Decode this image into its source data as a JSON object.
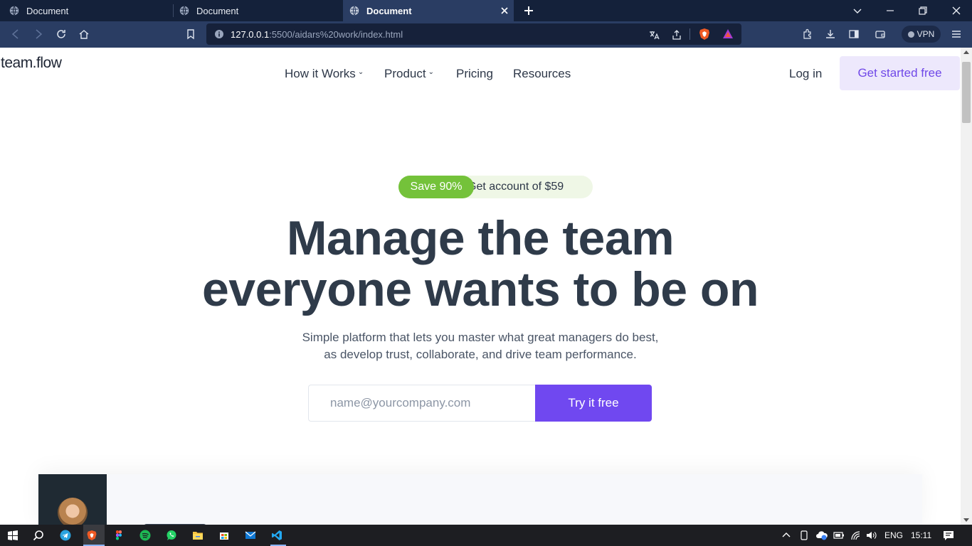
{
  "browser": {
    "tabs": [
      {
        "title": "Document",
        "active": false
      },
      {
        "title": "Document",
        "active": false
      },
      {
        "title": "Document",
        "active": true
      }
    ],
    "url_host": "127.0.0.1",
    "url_rest": ":5500/aidars%20work/index.html",
    "vpn_label": "VPN"
  },
  "header": {
    "logo": "team.flow",
    "nav": [
      {
        "label": "How it Works",
        "has_dropdown": true
      },
      {
        "label": "Product",
        "has_dropdown": true
      },
      {
        "label": "Pricing",
        "has_dropdown": false
      },
      {
        "label": "Resources",
        "has_dropdown": false
      }
    ],
    "login": "Log in",
    "cta": "Get started free"
  },
  "hero": {
    "badge": "Save 90%",
    "badge_text": "Get account of $59",
    "headline_line1": "Manage the team",
    "headline_line2": "everyone wants to be on",
    "sub_line1": "Simple platform that lets you master what great managers do best,",
    "sub_line2": "as develop trust, collaborate, and drive team performance.",
    "email_placeholder": "name@yourcompany.com",
    "submit": "Try it free"
  },
  "taskbar": {
    "language": "ENG",
    "time": "15:11"
  },
  "colors": {
    "accent": "#7048f0",
    "accent_light": "#ede8fc",
    "badge_green": "#74c23a",
    "heading": "#2f3b4a",
    "browser_dark": "#14213a",
    "browser_toolbar": "#2a3d63"
  }
}
